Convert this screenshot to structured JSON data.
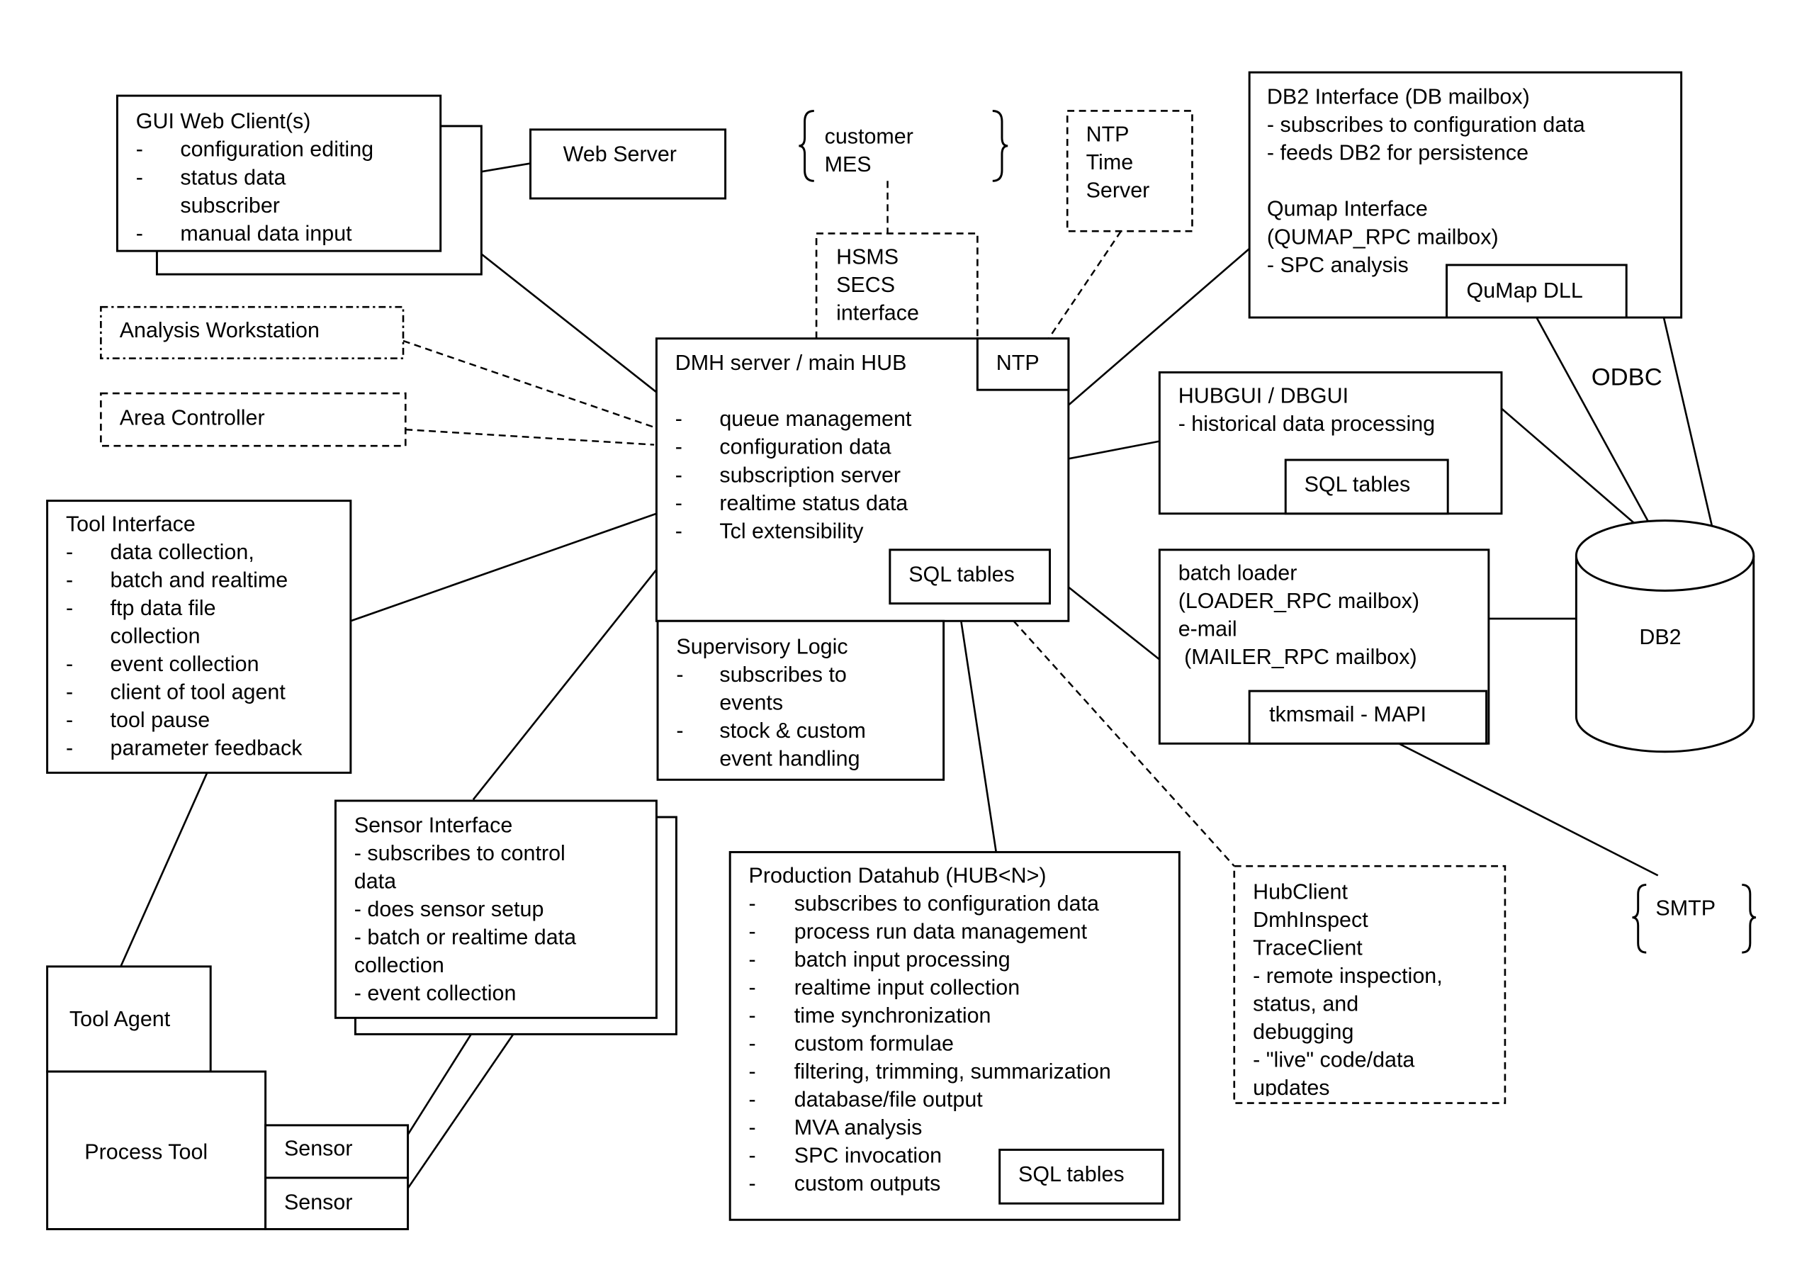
{
  "gui_web_client": {
    "title": "GUI Web Client(s)",
    "items": [
      "configuration editing",
      "status data",
      "subscriber",
      "manual data input"
    ],
    "bullets": [
      "-",
      "-",
      "",
      "-"
    ]
  },
  "web_server": {
    "label": "Web Server"
  },
  "customer_mes": {
    "lines": [
      "customer",
      "MES"
    ]
  },
  "ntp_time_server": {
    "lines": [
      "NTP",
      "Time",
      "Server"
    ]
  },
  "hsms": {
    "lines": [
      "HSMS",
      "SECS",
      "interface"
    ]
  },
  "db2_interface": {
    "lines": [
      "DB2 Interface (DB mailbox)",
      "- subscribes to configuration data",
      "- feeds DB2 for persistence",
      "",
      "Qumap Interface",
      "(QUMAP_RPC mailbox)",
      "- SPC analysis"
    ],
    "dll": "QuMap DLL"
  },
  "odbc_label": "ODBC",
  "analysis_workstation": {
    "label": "Analysis Workstation"
  },
  "area_controller": {
    "label": "Area Controller"
  },
  "main_hub": {
    "title": "DMH server / main HUB",
    "ntp": "NTP",
    "items": [
      "queue management",
      "configuration data",
      "subscription server",
      "realtime status data",
      "Tcl extensibility"
    ],
    "sql": "SQL tables"
  },
  "hubgui": {
    "lines": [
      "HUBGUI / DBGUI",
      "- historical data processing"
    ],
    "sql": "SQL tables"
  },
  "batch_loader": {
    "lines": [
      "batch loader",
      "(LOADER_RPC mailbox)",
      "e-mail",
      " (MAILER_RPC mailbox)"
    ],
    "mapi": "tkmsmail - MAPI"
  },
  "db2": {
    "label": "DB2"
  },
  "tool_interface": {
    "title": "Tool Interface",
    "items": [
      "data collection,",
      "batch and realtime",
      "ftp data file",
      "collection",
      "event collection",
      "client of tool agent",
      "tool pause",
      "parameter feedback"
    ],
    "bullets": [
      "-",
      "-",
      "-",
      "",
      "-",
      "-",
      "-",
      "-"
    ]
  },
  "supervisory": {
    "title": "Supervisory Logic",
    "items": [
      "subscribes to",
      "events",
      "stock & custom",
      "event handling"
    ],
    "bullets": [
      "-",
      "",
      "-",
      ""
    ]
  },
  "sensor_interface": {
    "lines": [
      "Sensor Interface",
      "- subscribes to control",
      "data",
      "- does sensor setup",
      "- batch or realtime data",
      "collection",
      "- event collection"
    ]
  },
  "production_datahub": {
    "title": "Production Datahub (HUB<N>)",
    "items": [
      "subscribes to configuration data",
      "process run data management",
      "batch input processing",
      "realtime input collection",
      "time synchronization",
      "custom formulae",
      "filtering, trimming, summarization",
      "database/file output",
      "MVA analysis",
      "SPC invocation",
      "custom outputs"
    ],
    "sql": "SQL tables"
  },
  "hubclient": {
    "lines": [
      "HubClient",
      "DmhInspect",
      "TraceClient",
      "- remote inspection,",
      "status, and",
      "debugging",
      "- \"live\" code/data",
      "updates"
    ]
  },
  "smtp": {
    "label": "SMTP"
  },
  "tool_agent": {
    "label": "Tool Agent"
  },
  "process_tool": {
    "label": "Process Tool"
  },
  "sensors": [
    "Sensor",
    "Sensor"
  ]
}
